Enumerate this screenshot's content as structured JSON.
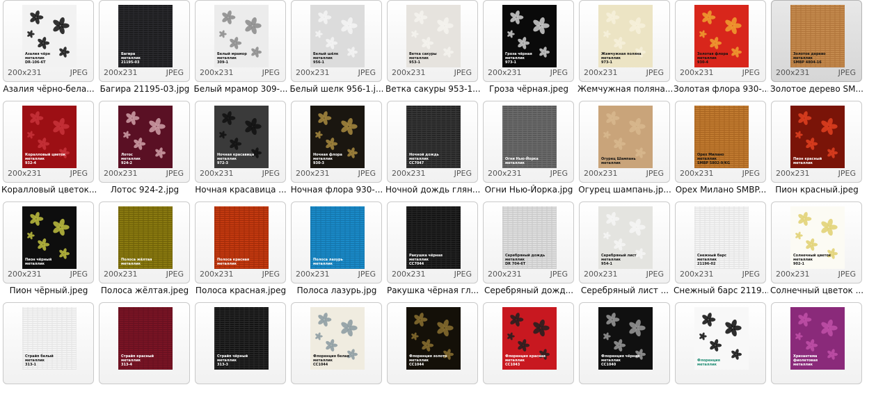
{
  "files": [
    {
      "name": "Азалия чёрно-бела...",
      "dims": "200x231",
      "type": "JPEG",
      "label": "Азалия чёрн\nметаллик\nDR-106-6T",
      "bg": "#f2f2f2",
      "stripe": "",
      "flower": "#111111",
      "lbl_color": "#111111"
    },
    {
      "name": "Багира 21195-03.jpg",
      "dims": "200x231",
      "type": "JPEG",
      "label": "Багира\nметаллик\n21195-03",
      "bg": "#1c1c1e",
      "stripe": "#2c2c30",
      "flower": "",
      "lbl_color": "#ffffff"
    },
    {
      "name": "Белый мрамор 309-...",
      "dims": "200x231",
      "type": "JPEG",
      "label": "Белый мрамор\nметаллик\n309-1",
      "bg": "#ececec",
      "stripe": "",
      "flower": "#8a8a8a",
      "lbl_color": "#111111"
    },
    {
      "name": "Белый шелк 956-1.j...",
      "dims": "200x231",
      "type": "JPEG",
      "label": "Белый шёлк\nметаллик\n956-1",
      "bg": "#dcdcdc",
      "stripe": "",
      "flower": "#f4f4f4",
      "lbl_color": "#111111"
    },
    {
      "name": "Ветка сакуры 953-1....",
      "dims": "200x231",
      "type": "JPEG",
      "label": "Ветка сакуры\nметаллик\n953-1",
      "bg": "#e6e3de",
      "stripe": "",
      "flower": "#f5f3ef",
      "lbl_color": "#111111"
    },
    {
      "name": "Гроза чёрная.jpeg",
      "dims": "200x231",
      "type": "JPEG",
      "label": "Гроза чёрная\nметаллик\n973-1",
      "bg": "#0a0a0a",
      "stripe": "",
      "flower": "#d0d0d0",
      "lbl_color": "#ffffff"
    },
    {
      "name": "Жемчужная поляна...",
      "dims": "200x231",
      "type": "JPEG",
      "label": "Жемчужная поляна\nметаллик\n973-1",
      "bg": "#ece4c4",
      "stripe": "",
      "flower": "#f7f1dc",
      "lbl_color": "#111111"
    },
    {
      "name": "Золотая флора 930-...",
      "dims": "200x231",
      "type": "JPEG",
      "label": "Золотая флора\nметаллик\n930-4",
      "bg": "#d8261b",
      "stripe": "",
      "flower": "#f0a030",
      "lbl_color": "#111111"
    },
    {
      "name": "Золотое дерево SM...",
      "dims": "200x231",
      "type": "JPEG",
      "label": "Золотое дерево\nметаллик\nSMBP 4804-16",
      "bg": "#c48a4e",
      "stripe": "#b0743a",
      "flower": "",
      "lbl_color": "#111111"
    },
    {
      "name": "Коралловый цветок...",
      "dims": "200x231",
      "type": "JPEG",
      "label": "Коралловый цветок\nметаллик\n932-4",
      "bg": "#9c0f14",
      "stripe": "",
      "flower": "#c8323a",
      "lbl_color": "#ffffff"
    },
    {
      "name": "Лотос 924-2.jpg",
      "dims": "200x231",
      "type": "JPEG",
      "label": "Лотос\nметаллик\n924-2",
      "bg": "#5a1024",
      "stripe": "",
      "flower": "#d0a0a8",
      "lbl_color": "#ffffff"
    },
    {
      "name": "Ночная красавица ...",
      "dims": "200x231",
      "type": "JPEG",
      "label": "Ночная красавица\nметаллик\n972-3",
      "bg": "#3a3a3a",
      "stripe": "",
      "flower": "#111111",
      "lbl_color": "#ffffff"
    },
    {
      "name": "Ночная флора 930-...",
      "dims": "200x231",
      "type": "JPEG",
      "label": "Ночная флора\nметаллик\n930-3",
      "bg": "#1a1610",
      "stripe": "",
      "flower": "#a88a40",
      "lbl_color": "#ffffff"
    },
    {
      "name": "Ночной дождь глян...",
      "dims": "200x231",
      "type": "JPEG",
      "label": "Ночной дождь\nметаллик\nCC7047",
      "bg": "#262626",
      "stripe": "#3a3a3a",
      "flower": "",
      "lbl_color": "#ffffff"
    },
    {
      "name": "Огни Нью-Йорка.jpg",
      "dims": "200x231",
      "type": "JPEG",
      "label": "Огни Нью-Йорка\nметаллик",
      "bg": "#5a5a5a",
      "stripe": "#6e6e6e",
      "flower": "",
      "lbl_color": "#ffffff"
    },
    {
      "name": "Огурец шампань.jp...",
      "dims": "200x231",
      "type": "JPEG",
      "label": "Огурец Шампань\nметаллик",
      "bg": "#c9a47a",
      "stripe": "",
      "flower": "#d8b88e",
      "lbl_color": "#111111"
    },
    {
      "name": "Орех Милано SMBP...",
      "dims": "200x231",
      "type": "JPEG",
      "label": "Орех Милано\nметаллик\nSMBP 5802-9/KG",
      "bg": "#c07a30",
      "stripe": "#a86420",
      "flower": "",
      "lbl_color": "#111111"
    },
    {
      "name": "Пион красный.jpeg",
      "dims": "200x231",
      "type": "JPEG",
      "label": "Пион красный\nметаллик",
      "bg": "#7a1408",
      "stripe": "",
      "flower": "#e04020",
      "lbl_color": "#ffffff"
    },
    {
      "name": "Пион чёрный.jpeg",
      "dims": "200x231",
      "type": "JPEG",
      "label": "Пион чёрный\nметаллик",
      "bg": "#0e0e0e",
      "stripe": "",
      "flower": "#c0c040",
      "lbl_color": "#ffffff"
    },
    {
      "name": "Полоса жёлтая.jpeg",
      "dims": "200x231",
      "type": "JPEG",
      "label": "Полоса жёлтая\nметаллик",
      "bg": "#8a7a10",
      "stripe": "#6e6008",
      "flower": "",
      "lbl_color": "#ffffff"
    },
    {
      "name": "Полоса красная.jpeg",
      "dims": "200x231",
      "type": "JPEG",
      "label": "Полоса красная\nметаллик",
      "bg": "#c43a10",
      "stripe": "#a02a08",
      "flower": "",
      "lbl_color": "#ffffff"
    },
    {
      "name": "Полоса лазурь.jpg",
      "dims": "200x231",
      "type": "JPEG",
      "label": "Полоса лазурь\nметаллик",
      "bg": "#1a8ac8",
      "stripe": "#1474aa",
      "flower": "",
      "lbl_color": "#ffffff"
    },
    {
      "name": "Ракушка чёрная гл...",
      "dims": "200x231",
      "type": "JPEG",
      "label": "Ракушка чёрная\nметаллик\nCC7044",
      "bg": "#141414",
      "stripe": "#262626",
      "flower": "",
      "lbl_color": "#ffffff"
    },
    {
      "name": "Серебряный дожд...",
      "dims": "200x231",
      "type": "JPEG",
      "label": "Серебряный дождь\nметаллик\nDR 704-6T",
      "bg": "#dedede",
      "stripe": "#c8c8c8",
      "flower": "",
      "lbl_color": "#111111"
    },
    {
      "name": "Серебряный лист ...",
      "dims": "200x231",
      "type": "JPEG",
      "label": "Серебряный лист\nметаллик\n954-1",
      "bg": "#e4e4e0",
      "stripe": "",
      "flower": "#f6f6f4",
      "lbl_color": "#111111"
    },
    {
      "name": "Снежный барс 2119...",
      "dims": "200x231",
      "type": "JPEG",
      "label": "Снежный барс\nметаллик\n21196-02",
      "bg": "#f4f4f4",
      "stripe": "#e2e2e2",
      "flower": "",
      "lbl_color": "#111111"
    },
    {
      "name": "Солнечный цветок ...",
      "dims": "200x231",
      "type": "JPEG",
      "label": "Солнечный цветок\nметаллик\n902-1",
      "bg": "#fcfbf4",
      "stripe": "",
      "flower": "#e0d070",
      "lbl_color": "#111111"
    },
    {
      "name": "",
      "dims": "",
      "type": "",
      "label": "Страйп белый\nметаллик\n313-1",
      "bg": "#f4f4f4",
      "stripe": "#e4e4e4",
      "flower": "",
      "lbl_color": "#111111"
    },
    {
      "name": "",
      "dims": "",
      "type": "",
      "label": "Страйп красный\nметаллик\n313-4",
      "bg": "#7a1424",
      "stripe": "#661020",
      "flower": "",
      "lbl_color": "#ffffff"
    },
    {
      "name": "",
      "dims": "",
      "type": "",
      "label": "Страйп чёрный\nметаллик\n313-3",
      "bg": "#141414",
      "stripe": "#2a2a2a",
      "flower": "",
      "lbl_color": "#ffffff"
    },
    {
      "name": "",
      "dims": "",
      "type": "",
      "label": "Флоренция белая\nметаллик\nCC1044",
      "bg": "#f0ece0",
      "stripe": "",
      "flower": "#8a9aa0",
      "lbl_color": "#111111"
    },
    {
      "name": "",
      "dims": "",
      "type": "",
      "label": "Флоренция золото\nметаллик\nCC1044",
      "bg": "#141008",
      "stripe": "",
      "flower": "#8a7030",
      "lbl_color": "#ffffff"
    },
    {
      "name": "",
      "dims": "",
      "type": "",
      "label": "Флоренция красная\nметаллик\nCC1043",
      "bg": "#c81820",
      "stripe": "",
      "flower": "#202020",
      "lbl_color": "#ffffff"
    },
    {
      "name": "",
      "dims": "",
      "type": "",
      "label": "Флоренция чёрная\nметаллик\nCC1040",
      "bg": "#101010",
      "stripe": "",
      "flower": "#9a9a9a",
      "lbl_color": "#ffffff"
    },
    {
      "name": "",
      "dims": "",
      "type": "",
      "label": "Флоренция\nметаллик",
      "bg": "#f8f8f8",
      "stripe": "",
      "flower": "#0a0a0a",
      "lbl_color": "#1a8a70"
    },
    {
      "name": "",
      "dims": "",
      "type": "",
      "label": "Хризантема\nфиолетовая\nметаллик",
      "bg": "#8a2a7a",
      "stripe": "",
      "flower": "#c050a8",
      "lbl_color": "#ffffff"
    }
  ],
  "selected_index": 8
}
